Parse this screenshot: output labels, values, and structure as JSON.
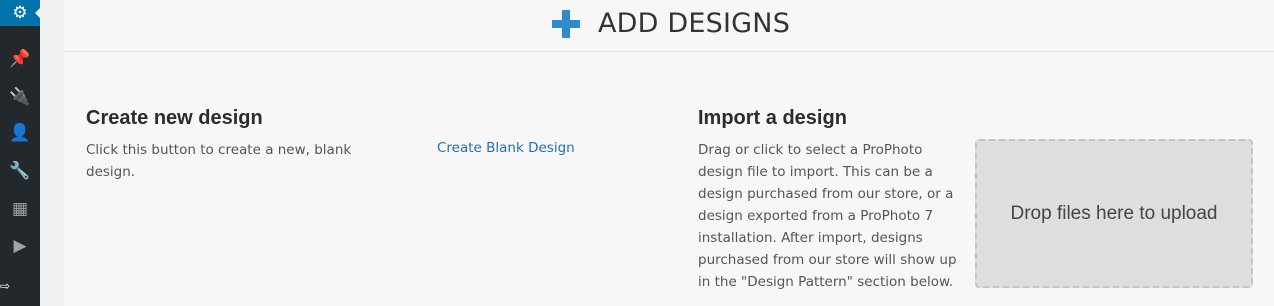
{
  "sidebar": {
    "items": [
      {
        "icon": "gear-icon",
        "glyph": "⚙"
      },
      {
        "icon": "pin-icon",
        "glyph": "📌"
      },
      {
        "icon": "plugin-icon",
        "glyph": "🔌"
      },
      {
        "icon": "user-icon",
        "glyph": "👤"
      },
      {
        "icon": "wrench-icon",
        "glyph": "🔧"
      },
      {
        "icon": "settings-sliders-icon",
        "glyph": "▦"
      },
      {
        "icon": "play-circle-icon",
        "glyph": "▶"
      }
    ],
    "cursor_glyph": "⇨"
  },
  "header": {
    "icon": "plus-icon",
    "title": "ADD DESIGNS"
  },
  "create": {
    "title": "Create new design",
    "description": "Click this button to create a new, blank design.",
    "button_label": "Create Blank Design"
  },
  "import": {
    "title": "Import a design",
    "description": "Drag or click to select a ProPhoto design file to import. This can be a design purchased from our store, or a design exported from a ProPhoto 7 installation. After import, designs purchased from our store will show up in the \"Design Pattern\" section below.",
    "dropzone_label": "Drop files here to upload"
  },
  "colors": {
    "sidebar_bg": "#23282d",
    "sidebar_active": "#0073aa",
    "accent_plus": "#2e8ccc",
    "link": "#2271b1"
  }
}
